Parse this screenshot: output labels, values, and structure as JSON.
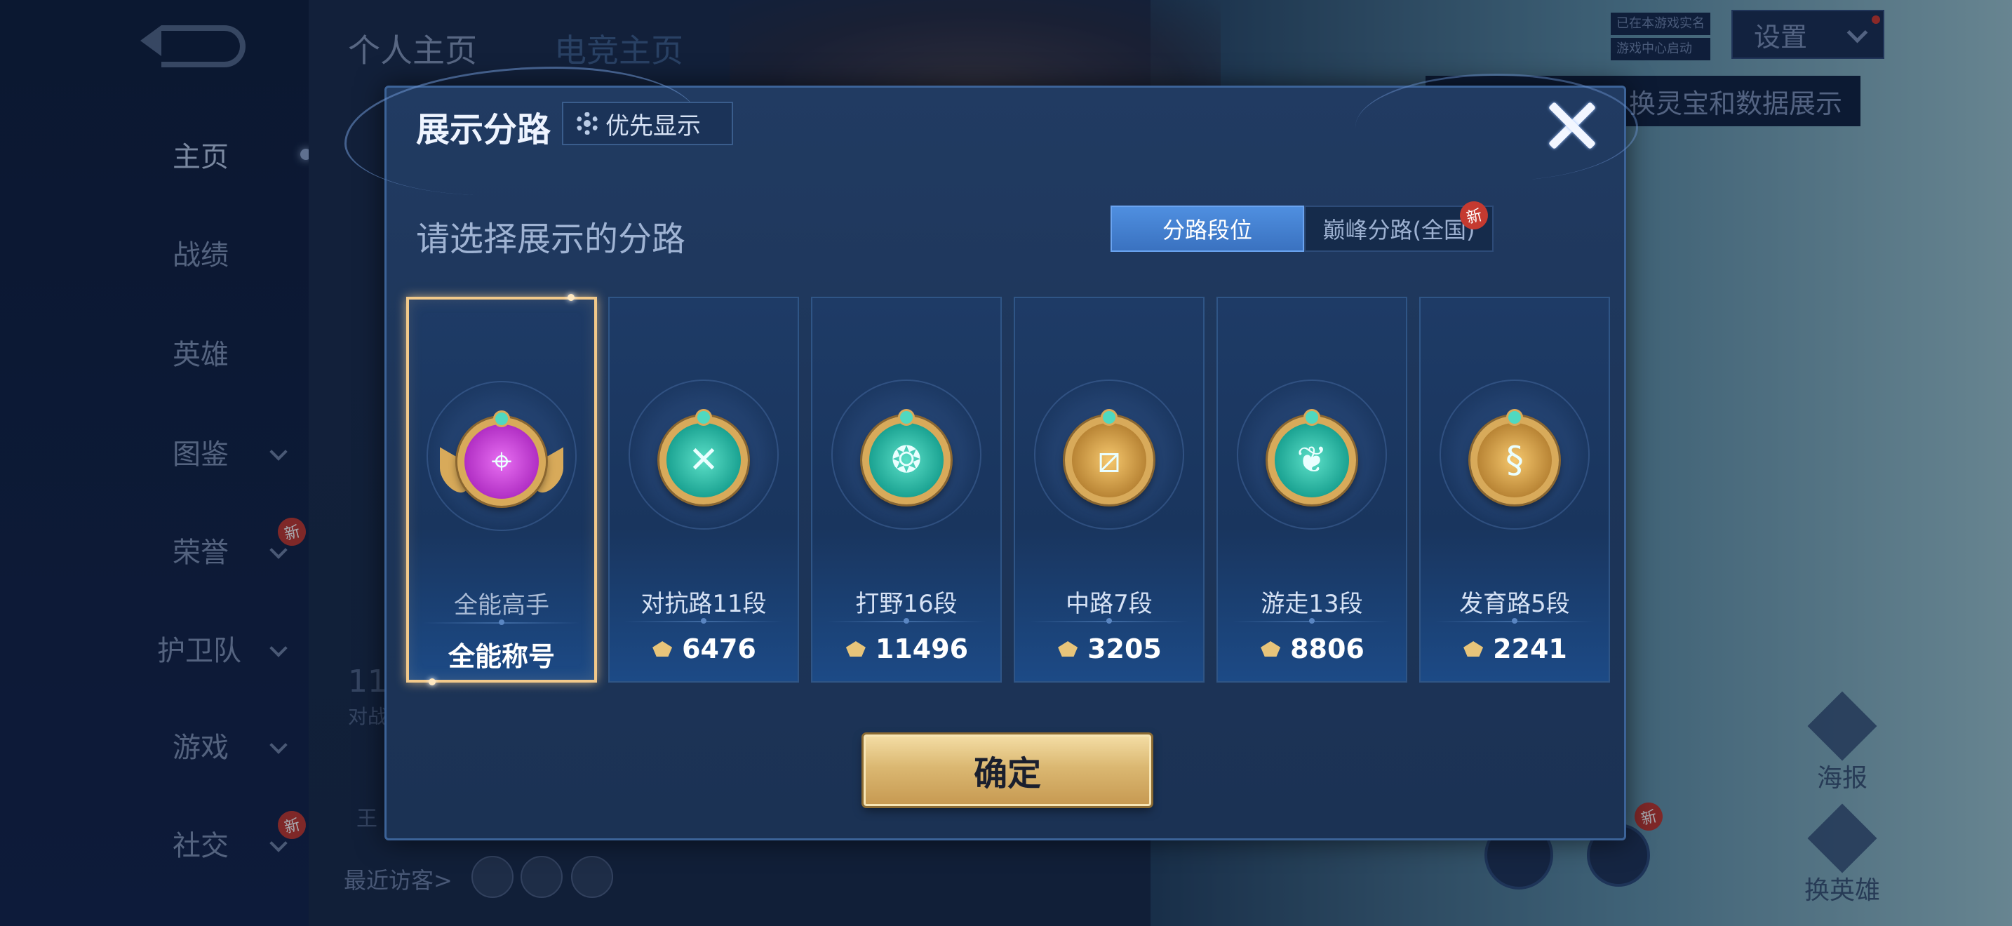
{
  "background": {
    "top_tabs": [
      "个人主页",
      "电竞主页"
    ],
    "nav": [
      {
        "label": "主页",
        "active": true,
        "chevron": false,
        "badge": ""
      },
      {
        "label": "战绩",
        "active": false,
        "chevron": false,
        "badge": ""
      },
      {
        "label": "英雄",
        "active": false,
        "chevron": false,
        "badge": ""
      },
      {
        "label": "图鉴",
        "active": false,
        "chevron": true,
        "badge": ""
      },
      {
        "label": "荣誉",
        "active": false,
        "chevron": true,
        "badge": "新"
      },
      {
        "label": "护卫队",
        "active": false,
        "chevron": true,
        "badge": ""
      },
      {
        "label": "游戏",
        "active": false,
        "chevron": true,
        "badge": ""
      },
      {
        "label": "社交",
        "active": false,
        "chevron": true,
        "badge": "新"
      }
    ],
    "settings_label": "设置",
    "small_tags": [
      "已在本游戏实名",
      "游戏中心启动"
    ],
    "tip_text": "换灵宝和数据展示",
    "recent_visitors_label": "最近访客>",
    "bg_number": "11",
    "bg_caption": "对战",
    "bg_king": "王",
    "right_icons": [
      "海报",
      "换英雄"
    ],
    "bottom_badge": "新"
  },
  "dialog": {
    "title": "展示分路",
    "priority_label": "优先显示",
    "subtitle": "请选择展示的分路",
    "tabs": [
      {
        "label": "分路段位",
        "active": true,
        "badge": ""
      },
      {
        "label": "巅峰分路(全国)",
        "active": false,
        "badge": "新"
      }
    ],
    "cards": [
      {
        "name": "全能高手",
        "value": "全能称号",
        "icon": "all-rounder-emblem",
        "color": "purple",
        "selected": true,
        "points_icon": false,
        "glyph": "⌖"
      },
      {
        "name": "对抗路11段",
        "value": "6476",
        "icon": "clash-lane-emblem",
        "color": "teal",
        "selected": false,
        "points_icon": true,
        "glyph": "✕"
      },
      {
        "name": "打野16段",
        "value": "11496",
        "icon": "jungle-dragon-emblem",
        "color": "teal",
        "selected": false,
        "points_icon": true,
        "glyph": "❂"
      },
      {
        "name": "中路7段",
        "value": "3205",
        "icon": "mid-lane-emblem",
        "color": "gold",
        "selected": false,
        "points_icon": true,
        "glyph": "⧄"
      },
      {
        "name": "游走13段",
        "value": "8806",
        "icon": "roam-wings-emblem",
        "color": "teal",
        "selected": false,
        "points_icon": true,
        "glyph": "❦"
      },
      {
        "name": "发育路5段",
        "value": "2241",
        "icon": "farm-lane-emblem",
        "color": "gold",
        "selected": false,
        "points_icon": true,
        "glyph": "§"
      }
    ],
    "confirm_label": "确定",
    "colors": {
      "accent_gold": "#f2c98a",
      "tab_active": "#4f8fe0",
      "badge_red": "#c53a30"
    }
  }
}
